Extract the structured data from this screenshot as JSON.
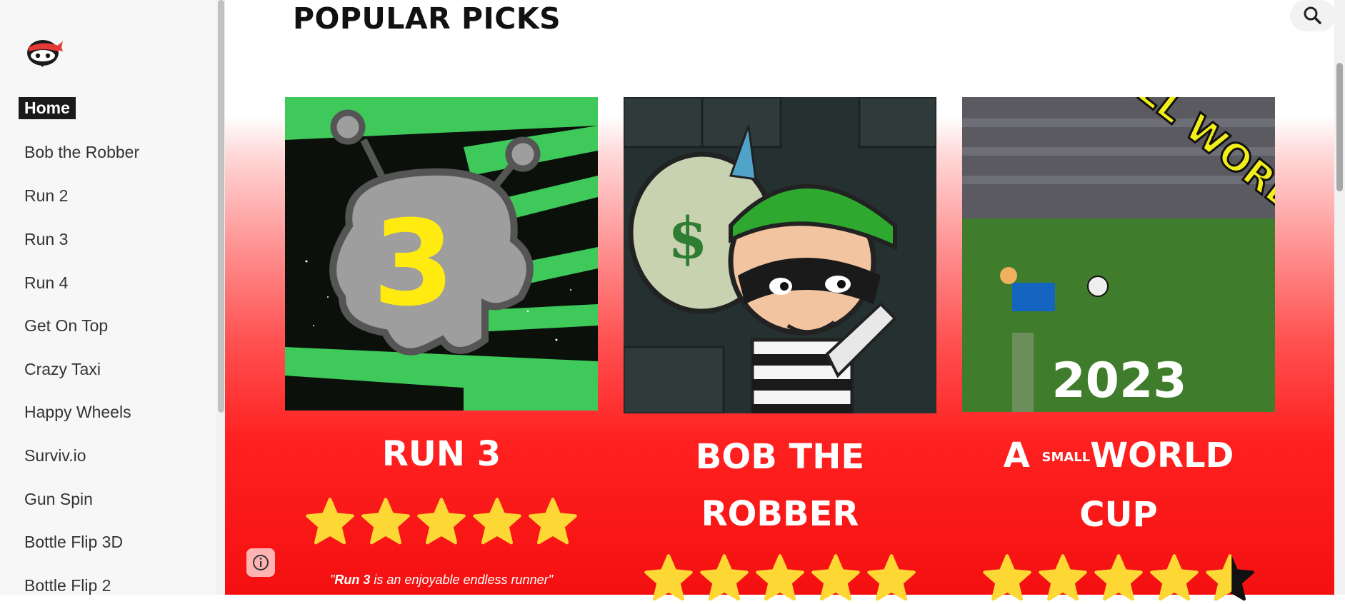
{
  "sidebar": {
    "items": [
      {
        "label": "Home",
        "active": true
      },
      {
        "label": "Bob the Robber"
      },
      {
        "label": "Run 2"
      },
      {
        "label": "Run 3"
      },
      {
        "label": "Run 4"
      },
      {
        "label": "Get On Top"
      },
      {
        "label": "Crazy Taxi"
      },
      {
        "label": "Happy Wheels"
      },
      {
        "label": "Surviv.io"
      },
      {
        "label": "Gun Spin"
      },
      {
        "label": "Bottle Flip 3D"
      },
      {
        "label": "Bottle Flip 2"
      }
    ]
  },
  "main": {
    "title": "POPULAR PICKS",
    "cards": [
      {
        "title": "RUN 3",
        "rating": 5,
        "quote_bold": "Run 3",
        "quote_rest": " is an enjoyable endless runner\""
      },
      {
        "title_line1": "BOB THE",
        "title_line2": "ROBBER",
        "rating": 5
      },
      {
        "title_a": "A",
        "title_small": "SMALL",
        "title_world": "WORLD",
        "title_line2": "CUP",
        "rating": 4.5,
        "image_text": "2023",
        "image_banner": "A SMALL WORLD CUP!!"
      }
    ]
  },
  "colors": {
    "accent_red": "#f41010",
    "star_yellow": "#fdd835",
    "sidebar_bg": "#f7f7f7"
  },
  "icons": [
    "ninja-logo-icon",
    "search-icon",
    "info-icon",
    "star-icon",
    "half-star-icon"
  ]
}
